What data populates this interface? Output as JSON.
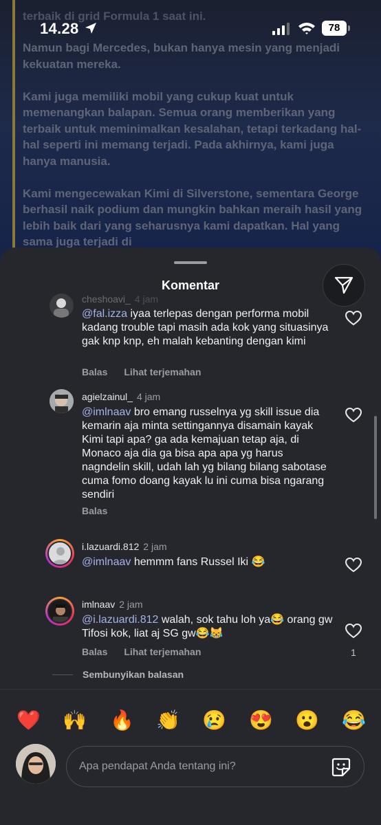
{
  "status_bar": {
    "time": "14.28",
    "battery": "78",
    "icons": [
      "location-arrow-icon",
      "signal-icon",
      "wifi-icon",
      "battery-icon"
    ]
  },
  "background_post": {
    "first_line": "terbaik di grid Formula 1 saat ini.",
    "paragraphs": [
      "Namun bagi Mercedes, bukan hanya mesin yang menjadi kekuatan mereka.",
      "Kami juga memiliki mobil yang cukup kuat untuk memenangkan balapan. Semua orang memberikan yang terbaik untuk meminimalkan kesalahan, tetapi terkadang hal-hal seperti ini memang terjadi. Pada akhirnya, kami juga hanya manusia.",
      "Kami mengecewakan Kimi di Silverstone, sementara George berhasil naik podium dan mungkin bahkan meraih hasil yang lebih baik dari yang seharusnya kami dapatkan. Hal yang sama juga terjadi di"
    ]
  },
  "sheet": {
    "title": "Komentar",
    "filter_icon": "send-icon"
  },
  "comments": [
    {
      "username": "cheshoavi_",
      "ago": "4 jam",
      "mention": "@fal.izza",
      "text": " iyaa terlepas dengan performa mobil kadang trouble tapi masih ada kok yang situasinya gak knp knp, eh malah kebanting dengan kimi",
      "reply_label": "Balas",
      "translate_label": "Lihat terjemahan",
      "likes": ""
    },
    {
      "username": "agielzainul_",
      "ago": "4 jam",
      "mention": "@imlnaav",
      "text": " bro emang russelnya yg skill issue dia kemarin aja minta settingannya disamain kayak Kimi tapi apa? ga ada kemajuan tetap aja, di Monaco aja dia ga bisa apa apa yg harus nagndelin skill, udah lah yg bilang bilang sabotase cuma fomo doang kayak lu ini cuma bisa ngarang sendiri",
      "reply_label": "Balas",
      "translate_label": "",
      "likes": ""
    },
    {
      "username": "i.lazuardi.812",
      "ago": "2 jam",
      "mention": "@imlnaav",
      "text": " hemmm fans Russel Iki 😂",
      "reply_label": "",
      "translate_label": "",
      "likes": ""
    },
    {
      "username": "imlnaav",
      "ago": "2 jam",
      "mention": "@i.lazuardi.812",
      "text": " walah, sok tahu loh ya😂 orang gw Tifosi kok, liat aj SG gw😂😹",
      "reply_label": "Balas",
      "translate_label": "Lihat terjemahan",
      "likes": "1"
    }
  ],
  "hide_replies": "Sembunyikan balasan",
  "emojis": [
    "❤️",
    "🙌",
    "🔥",
    "👏",
    "😢",
    "😍",
    "😮",
    "😂"
  ],
  "composer": {
    "placeholder": "Apa pendapat Anda tentang ini?",
    "sticker_icon": "sticker-icon"
  },
  "colors": {
    "sheet_bg": "#25272c",
    "mention": "#a5b4e8",
    "muted": "#9b9da2"
  }
}
